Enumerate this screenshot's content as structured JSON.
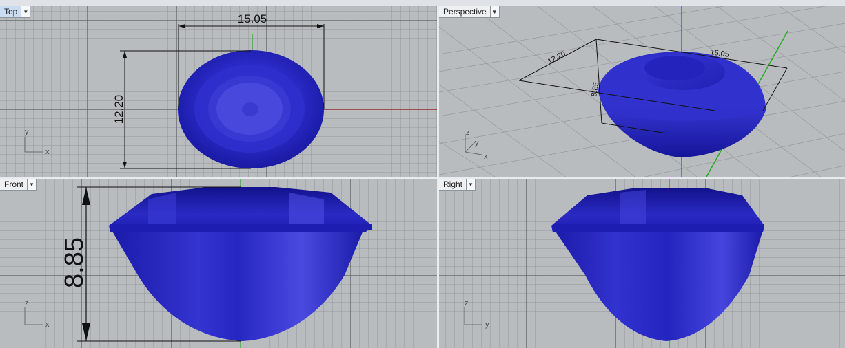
{
  "viewports": {
    "top": {
      "title": "Top",
      "dimension_width": "15.05",
      "dimension_height": "12.20",
      "axis_x": "x",
      "axis_y": "y"
    },
    "perspective": {
      "title": "Perspective",
      "dimension_width": "15.05",
      "dimension_depth": "12.20",
      "dimension_height": "8.85",
      "axis_x": "x",
      "axis_y": "y",
      "axis_z": "z"
    },
    "front": {
      "title": "Front",
      "dimension_height": "8.85",
      "axis_x": "x",
      "axis_z": "z"
    },
    "right": {
      "title": "Right",
      "axis_y": "y",
      "axis_z": "z"
    }
  },
  "colors": {
    "gem": "#1f1fb8",
    "gem_light": "#5555e8",
    "x_axis": "#b03030",
    "y_axis": "#22aa22",
    "z_axis": "#4a4ac8",
    "active_tab": "#c9dcf3"
  },
  "icons": {
    "dropdown": "chevron-down-icon"
  }
}
